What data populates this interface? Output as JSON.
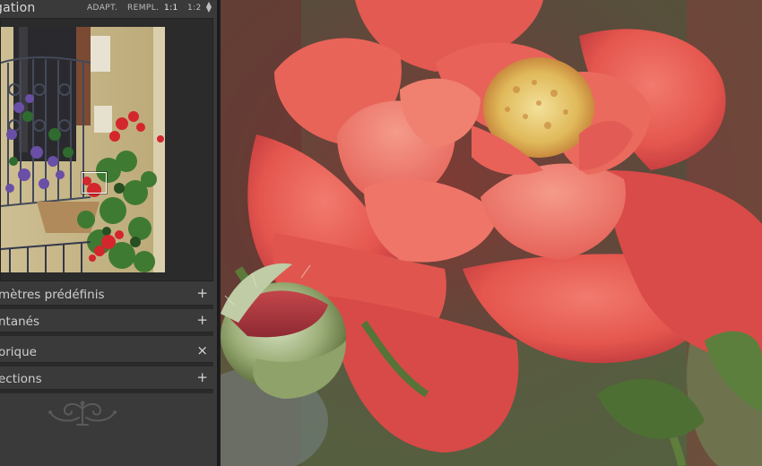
{
  "navigator": {
    "title": "gation",
    "zoom_options": {
      "fit": "ADAPT.",
      "fill": "REMPL.",
      "one_to_one": "1:1",
      "one_to_two": "1:2"
    },
    "zoom_stepper_icon": "up-down-arrows-icon"
  },
  "sections": [
    {
      "label": "mètres prédéfinis",
      "icon": "plus-icon",
      "icon_glyph": "+"
    },
    {
      "label": "ntanés",
      "icon": "plus-icon",
      "icon_glyph": "+"
    },
    {
      "label": "orique",
      "icon": "close-icon",
      "icon_glyph": "×"
    },
    {
      "label": "ections",
      "icon": "plus-dropdown-icon",
      "icon_glyph": "+"
    }
  ],
  "colors": {
    "panel_bg": "#3a3a3a",
    "panel_dark": "#2b2b2b",
    "text": "#cfcfcf",
    "active_zoom": "#f0f0f0"
  }
}
